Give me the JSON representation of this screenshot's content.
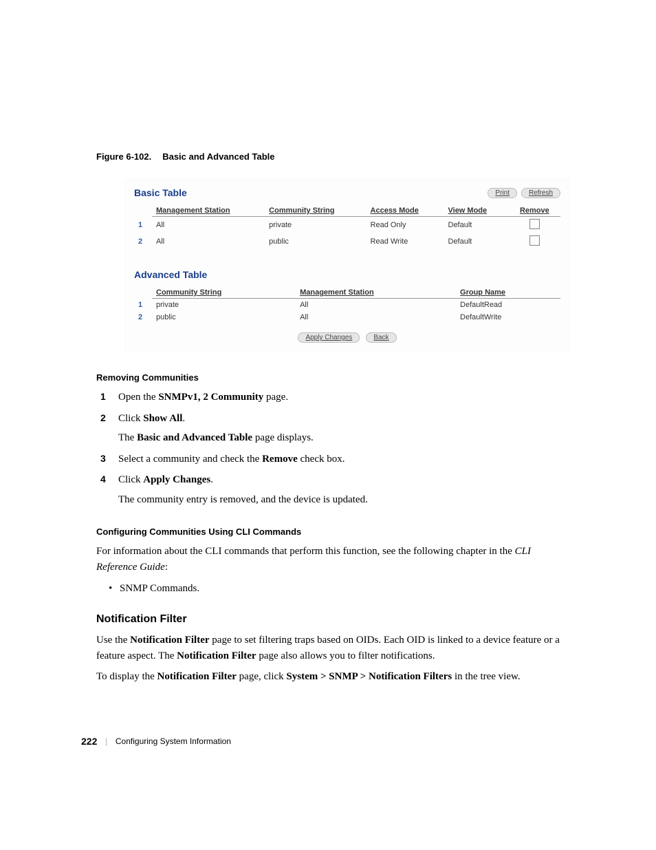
{
  "figure": {
    "number": "Figure 6-102.",
    "title": "Basic and Advanced Table"
  },
  "screenshot": {
    "basic": {
      "title": "Basic Table",
      "buttons": {
        "print": "Print",
        "refresh": "Refresh"
      },
      "headers": {
        "mgmt": "Management Station",
        "comm": "Community String",
        "access": "Access Mode",
        "view": "View Mode",
        "remove": "Remove"
      },
      "rows": [
        {
          "n": "1",
          "mgmt": "All",
          "comm": "private",
          "access": "Read Only",
          "view": "Default"
        },
        {
          "n": "2",
          "mgmt": "All",
          "comm": "public",
          "access": "Read Write",
          "view": "Default"
        }
      ]
    },
    "advanced": {
      "title": "Advanced Table",
      "headers": {
        "comm": "Community String",
        "mgmt": "Management Station",
        "group": "Group Name"
      },
      "rows": [
        {
          "n": "1",
          "comm": "private",
          "mgmt": "All",
          "group": "DefaultRead"
        },
        {
          "n": "2",
          "comm": "public",
          "mgmt": "All",
          "group": "DefaultWrite"
        }
      ]
    },
    "footer_buttons": {
      "apply": "Apply Changes",
      "back": "Back"
    }
  },
  "removing": {
    "heading": "Removing Communities",
    "steps": {
      "s1a": "Open the ",
      "s1b": "SNMPv1, 2 Community",
      "s1c": " page.",
      "s2a": "Click ",
      "s2b": "Show All",
      "s2c": ".",
      "s2d_a": "The ",
      "s2d_b": "Basic and Advanced Table",
      "s2d_c": " page displays.",
      "s3a": "Select a community and check the ",
      "s3b": "Remove",
      "s3c": " check box.",
      "s4a": "Click ",
      "s4b": "Apply Changes",
      "s4c": ".",
      "s4d": "The community entry is removed, and the device is updated."
    },
    "nums": {
      "n1": "1",
      "n2": "2",
      "n3": "3",
      "n4": "4"
    }
  },
  "cli": {
    "heading": "Configuring Communities Using CLI Commands",
    "p1": "For information about the CLI commands that perform this function, see the following chapter in the ",
    "ref": "CLI Reference Guide",
    "p1_end": ":",
    "item": "SNMP Commands."
  },
  "notif": {
    "heading": "Notification Filter",
    "p1a": "Use the ",
    "p1b": "Notification Filter",
    "p1c": " page to set filtering traps based on OIDs. Each OID is linked to a device feature or a feature aspect. The ",
    "p1d": "Notification Filter",
    "p1e": " page also allows you to filter notifications.",
    "p2a": "To display the ",
    "p2b": "Notification Filter",
    "p2c": " page, click ",
    "p2d": "System > SNMP > Notification Filters",
    "p2e": " in the tree view."
  },
  "footer": {
    "page": "222",
    "chapter": "Configuring System Information"
  }
}
